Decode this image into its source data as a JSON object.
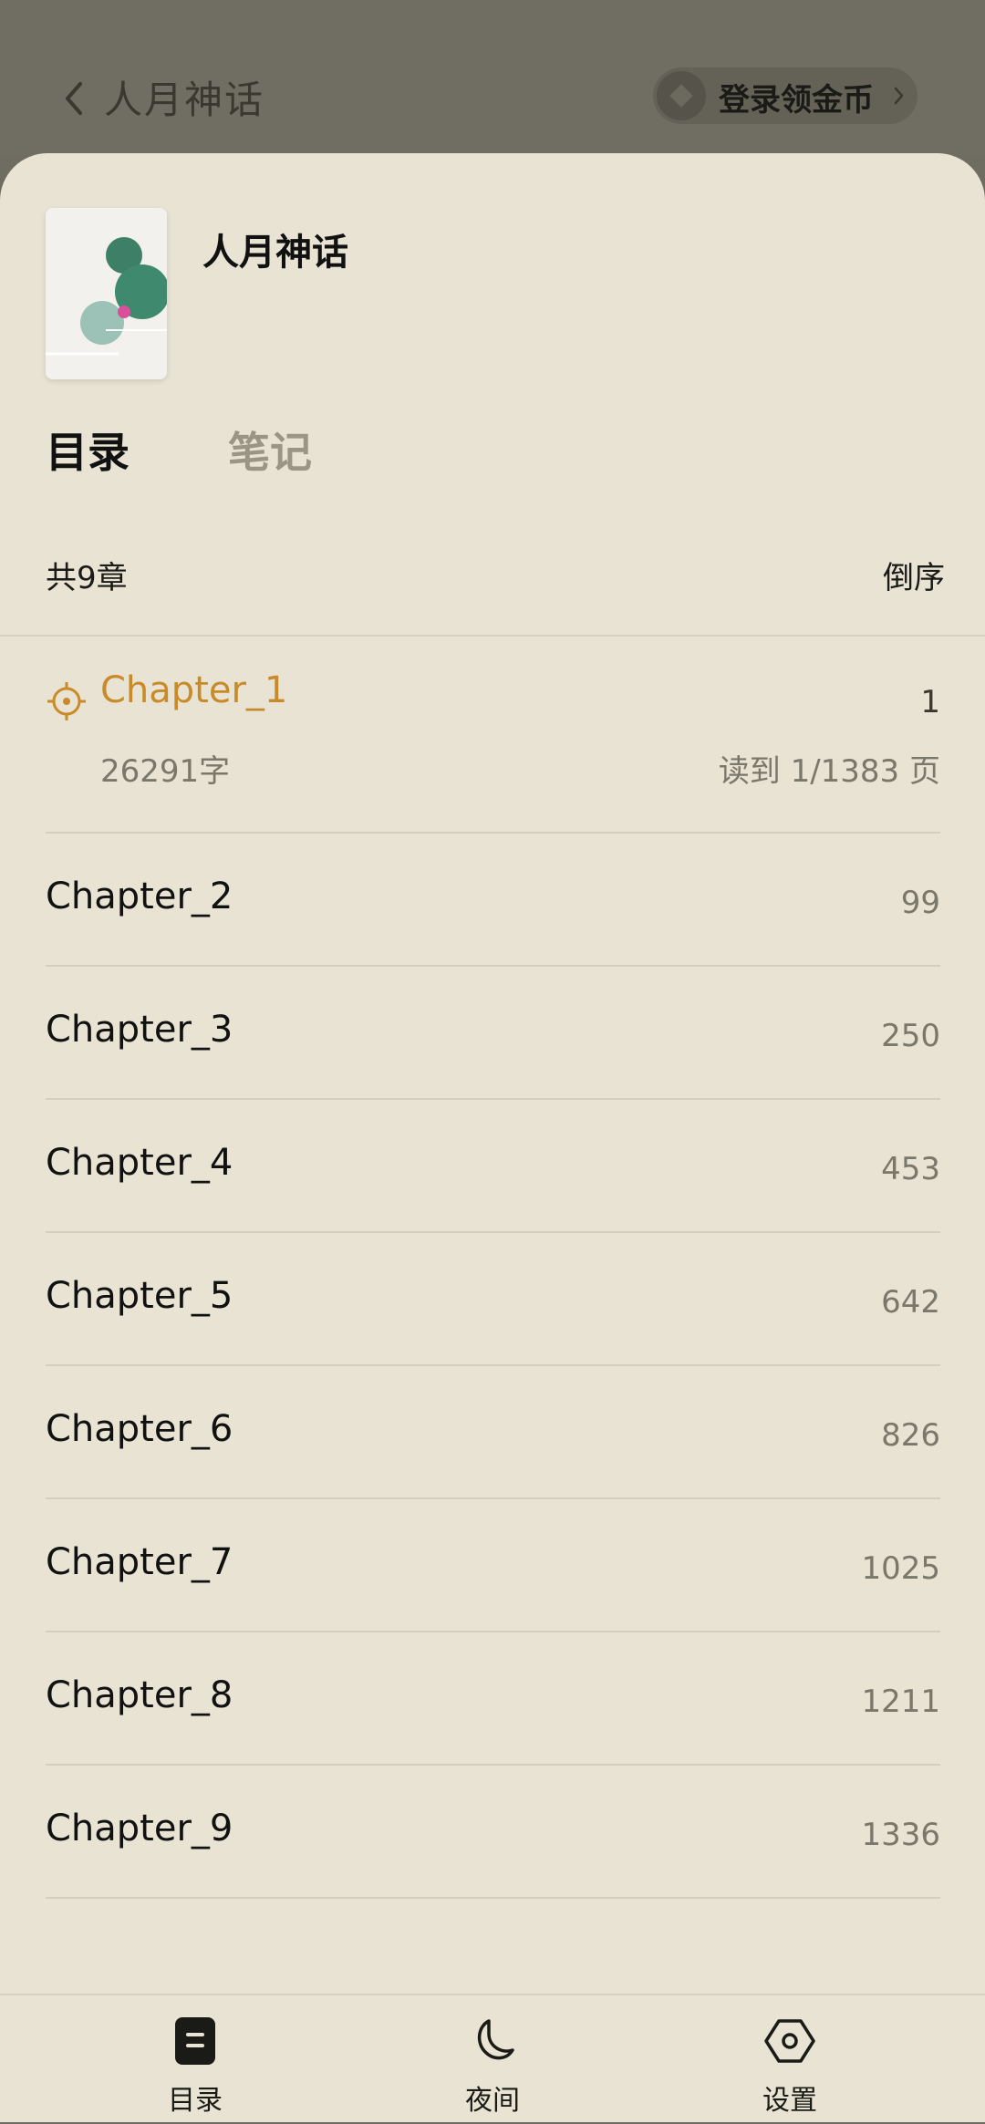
{
  "header": {
    "title": "人月神话",
    "login_label": "登录领金币"
  },
  "book": {
    "title": "人月神话"
  },
  "tabs": [
    "目录",
    "笔记"
  ],
  "toc": {
    "count_label": "共9章",
    "sort_label": "倒序",
    "current": {
      "name": "Chapter_1",
      "page": "1",
      "words": "26291字",
      "progress": "读到 1/1383 页"
    },
    "chapters": [
      {
        "name": "Chapter_2",
        "page": "99"
      },
      {
        "name": "Chapter_3",
        "page": "250"
      },
      {
        "name": "Chapter_4",
        "page": "453"
      },
      {
        "name": "Chapter_5",
        "page": "642"
      },
      {
        "name": "Chapter_6",
        "page": "826"
      },
      {
        "name": "Chapter_7",
        "page": "1025"
      },
      {
        "name": "Chapter_8",
        "page": "1211"
      },
      {
        "name": "Chapter_9",
        "page": "1336"
      }
    ]
  },
  "bottom_nav": [
    {
      "label": "目录",
      "icon": "toc-icon"
    },
    {
      "label": "夜间",
      "icon": "moon-icon"
    },
    {
      "label": "设置",
      "icon": "settings-icon"
    }
  ],
  "colors": {
    "sheet_bg": "#e8e3d2",
    "accent": "#c98b2a",
    "overlay": "#706e63"
  }
}
